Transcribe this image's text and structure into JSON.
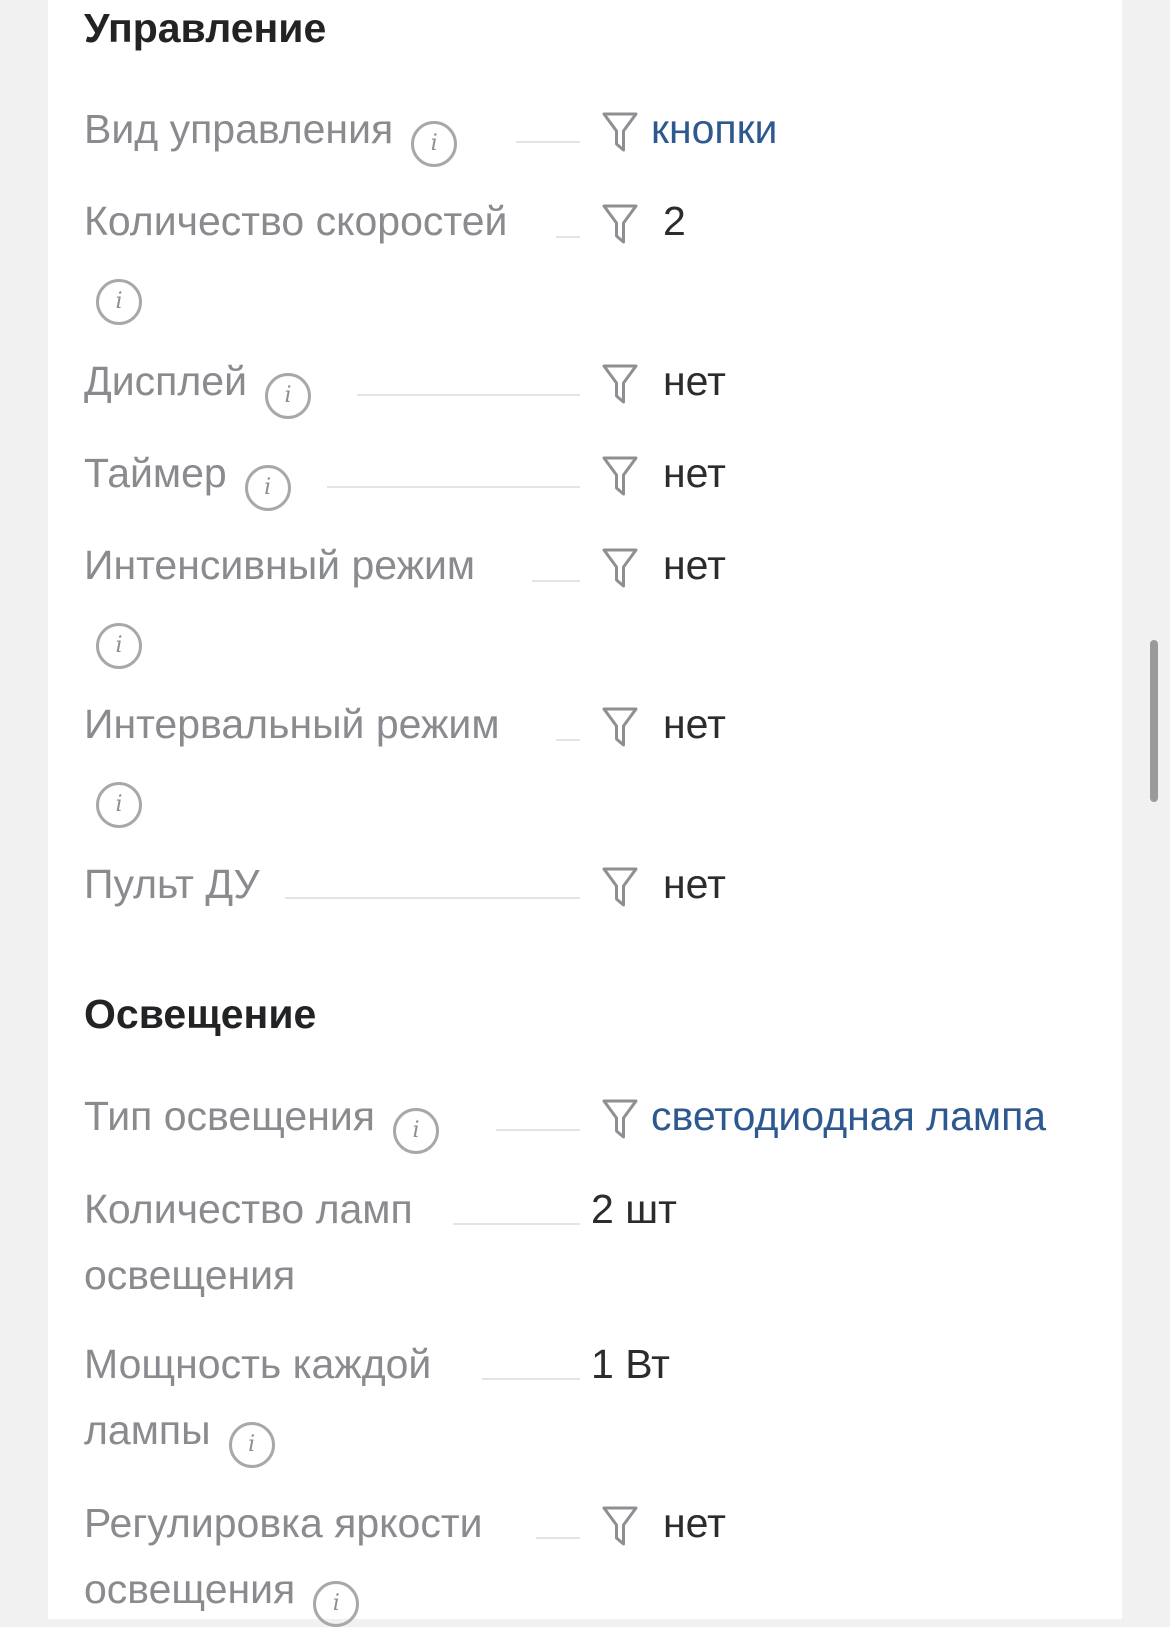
{
  "sections": [
    {
      "title": "Управление",
      "rows": [
        {
          "label": "Вид управления",
          "value": "кнопки",
          "value_is_link": true,
          "has_info": true,
          "has_filter": true
        },
        {
          "label": "Количество скоростей",
          "value": "2",
          "value_is_link": false,
          "has_info": true,
          "has_filter": true
        },
        {
          "label": "Дисплей",
          "value": "нет",
          "value_is_link": false,
          "has_info": true,
          "has_filter": true
        },
        {
          "label": "Таймер",
          "value": "нет",
          "value_is_link": false,
          "has_info": true,
          "has_filter": true
        },
        {
          "label": "Интенсивный режим",
          "value": "нет",
          "value_is_link": false,
          "has_info": true,
          "has_filter": true
        },
        {
          "label": "Интервальный режим",
          "value": "нет",
          "value_is_link": false,
          "has_info": true,
          "has_filter": true
        },
        {
          "label": "Пульт ДУ",
          "value": "нет",
          "value_is_link": false,
          "has_info": false,
          "has_filter": true
        }
      ]
    },
    {
      "title": "Освещение",
      "rows": [
        {
          "label": "Тип освещения",
          "value": "светодиодная лампа",
          "value_is_link": true,
          "has_info": true,
          "has_filter": true
        },
        {
          "label": "Количество ламп освещения",
          "value": "2 шт",
          "value_is_link": false,
          "has_info": false,
          "has_filter": false
        },
        {
          "label": "Мощность каждой лампы",
          "value": "1 Вт",
          "value_is_link": false,
          "has_info": true,
          "has_filter": false
        },
        {
          "label": "Регулировка яркости освещения",
          "value": "нет",
          "value_is_link": false,
          "has_info": true,
          "has_filter": true
        }
      ]
    }
  ],
  "icons": {
    "info": "info-circle-icon",
    "filter": "filter-funnel-icon"
  },
  "colors": {
    "label": "#8a8b8f",
    "value": "#2b2c2e",
    "link": "#2e5890",
    "heading": "#222325"
  }
}
